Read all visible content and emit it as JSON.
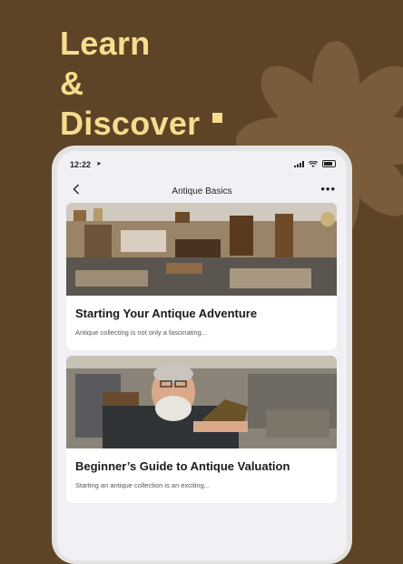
{
  "headline": {
    "line1": "Learn",
    "line2": "&",
    "line3": "Discover"
  },
  "colors": {
    "background": "#5e4426",
    "accent": "#f6dc8e",
    "card": "#ffffff"
  },
  "status_bar": {
    "time": "12:22"
  },
  "nav": {
    "title": "Antique Basics"
  },
  "articles": [
    {
      "title": "Starting Your Antique Adventure",
      "excerpt": "Antique collecting is not only a fascinating..."
    },
    {
      "title": "Beginner’s Guide to Antique Valuation",
      "excerpt": "Starting an antique collection is an exciting..."
    }
  ],
  "icons": [
    "flower-icon",
    "location-arrow-icon",
    "signal-icon",
    "wifi-icon",
    "battery-icon",
    "chevron-left-icon",
    "more-horizontal-icon"
  ]
}
